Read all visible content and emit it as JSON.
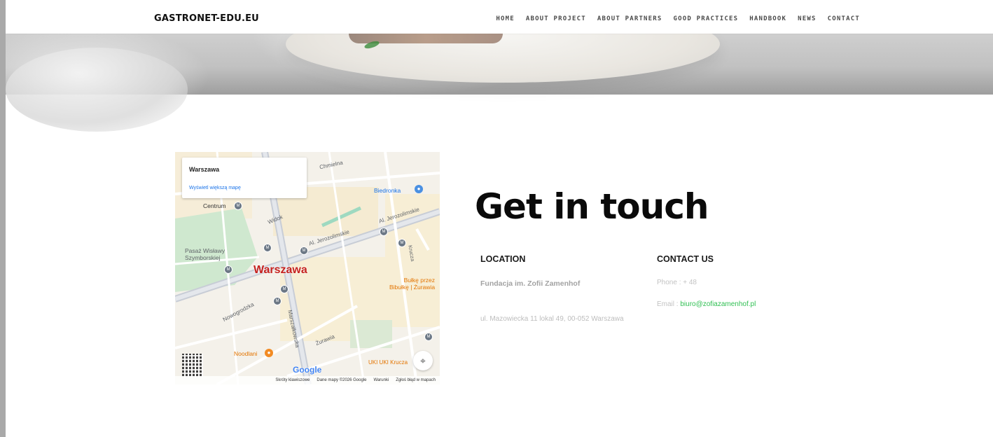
{
  "header": {
    "logo": "GASTRONET-EDU.EU",
    "nav": [
      {
        "label": "HOME"
      },
      {
        "label": "ABOUT PROJECT"
      },
      {
        "label": "ABOUT PARTNERS"
      },
      {
        "label": "GOOD PRACTICES"
      },
      {
        "label": "HANDBOOK"
      },
      {
        "label": "NEWS"
      },
      {
        "label": "CONTACT"
      }
    ]
  },
  "map": {
    "card_title": "Warszawa",
    "card_link": "Wyświetl większą mapę",
    "city_label": "Warszawa",
    "labels": {
      "chmielna": "Chmielna",
      "centrum": "Centrum",
      "widok": "Widok",
      "al_jerozolimskie_1": "Al. Jerozolimskie",
      "al_jerozolimskie_2": "Al. Jerozolimskie",
      "pasaz": "Pasaż Wisławy\nSzymborskiej",
      "krucza": "Krucza",
      "nowogrodzka": "Nowogrodzka",
      "marszalkowska": "Marszałkowska",
      "zurawia": "Żurawia"
    },
    "pois": {
      "biedronka": "Biedronka",
      "bulke": "Bułkę przez\nBibułkę | Żurawia",
      "noodlani": "Noodlani",
      "ukiuki": "UKI UKI Krucza"
    },
    "brand": "Google",
    "attribution": [
      "Skróty klawiszowe",
      "Dane mapy ©2026 Google",
      "Warunki",
      "Zgłoś błąd w mapach"
    ]
  },
  "contact": {
    "title": "Get in touch",
    "location_heading": "LOCATION",
    "location_name": "Fundacja im. Zofii Zamenhof",
    "location_address": "ul. Mazowiecka 11 lokal 49, 00-052 Warszawa",
    "contact_heading": "CONTACT US",
    "phone": "Phone : + 48",
    "email_label": "Email : ",
    "email": "biuro@zofiazamenhof.pl"
  },
  "colors": {
    "accent_green": "#2fbf52",
    "map_red": "#c5221f"
  }
}
